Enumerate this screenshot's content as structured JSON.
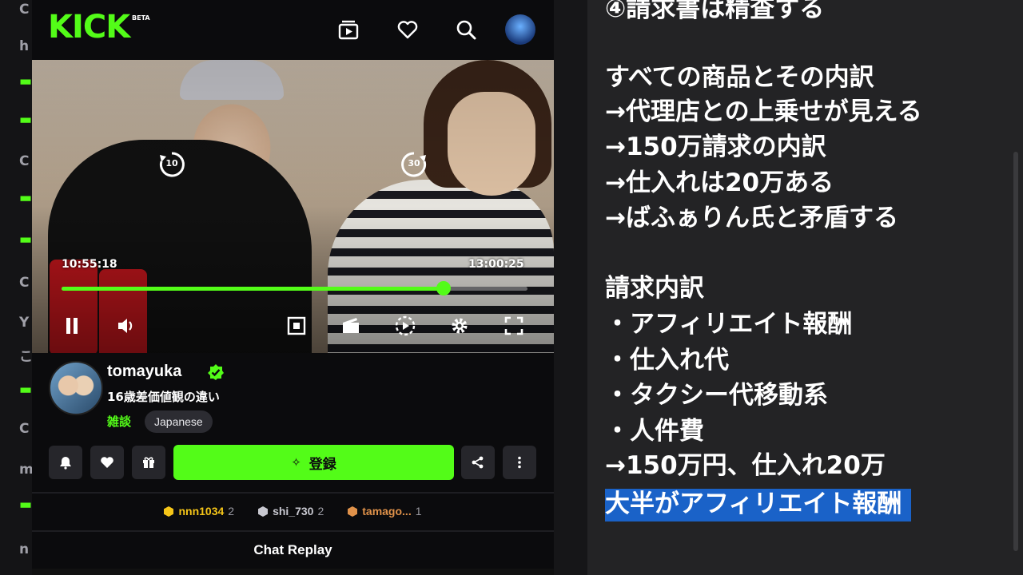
{
  "app": {
    "logo": "KICK",
    "logo_badge": "BETA",
    "nav_icons": [
      "browse-icon",
      "heart-icon",
      "search-icon",
      "user-avatar"
    ]
  },
  "player": {
    "skip_back": "10",
    "skip_forward": "30",
    "current_time": "10:55:18",
    "duration": "13:00:25",
    "progress": 0.82,
    "accent": "#53fc18"
  },
  "channel": {
    "name": "tomayuka",
    "title": "16歳差価値観の違い",
    "category": "雑談",
    "language": "Japanese",
    "subscribe_label": "登録"
  },
  "gifters": [
    {
      "name": "nnn1034",
      "count": "2",
      "color": "#f5c518"
    },
    {
      "name": "shi_730",
      "count": "2",
      "color": "#c8c8d0"
    },
    {
      "name": "tamago...",
      "count": "1",
      "color": "#e0924a"
    }
  ],
  "chat": {
    "replay_label": "Chat Replay"
  },
  "edge_chars": [
    "C",
    "h",
    "a",
    "a",
    "C",
    "a",
    "a",
    "C",
    "Y",
    "こ",
    "a",
    "C",
    "m",
    "a",
    "n"
  ],
  "notes": {
    "lines": [
      "④請求書は精査する",
      "",
      "すべての商品とその内訳",
      "→代理店との上乗せが見える",
      "→150万請求の内訳",
      "→仕入れは20万ある",
      "→ばふぁりん氏と矛盾する",
      "",
      "請求内訳",
      "・アフィリエイト報酬",
      "・仕入れ代",
      "・タクシー代移動系",
      "・人件費",
      "→150万円、仕入れ20万",
      "大半がアフィリエイト報酬"
    ],
    "highlight_color": "#1a62c8"
  }
}
